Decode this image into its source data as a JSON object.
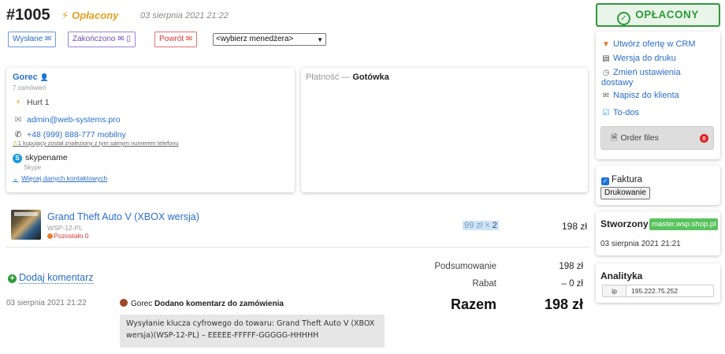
{
  "header": {
    "order_number": "#1005",
    "status": "Opłacony",
    "date": "03 sierpnia 2021 21:22"
  },
  "status_buttons": {
    "sent": "Wysłane",
    "completed": "Zakończono",
    "returned": "Powrót"
  },
  "manager_select": {
    "value": "<wybierz menedżera>"
  },
  "client": {
    "name": "Gorec",
    "orders": "7 zamówień",
    "price_group": "Hurt 1",
    "email": "admin@web-systems.pro",
    "phone": "+48 (999) 888-777 mobilny",
    "phone_warning": "1 kupujący został znaleziony z tym samym numerem telefonu",
    "skype": "skypename",
    "skype_label": "Skype",
    "more_contacts": "Więcej danych kontaktowych"
  },
  "payment": {
    "label": "Płatność —",
    "method": "Gotówka"
  },
  "product": {
    "name": "Grand Theft Auto V (XBOX wersja)",
    "sku": "WSP-12-PL",
    "stock": "Pozostało 0",
    "unit_price": "99 zł ×",
    "quantity": "2",
    "line_total": "198 zł"
  },
  "summary": {
    "subtotal_label": "Podsumowanie",
    "subtotal_value": "198 zł",
    "discount_label": "Rabat",
    "discount_value": "– 0 zł",
    "total_label": "Razem",
    "total_value": "198 zł"
  },
  "comments": {
    "add_label": "Dodaj komentarz",
    "items": [
      {
        "date": "03 sierpnia 2021 21:22",
        "author": "Gorec",
        "action": "Dodano komentarz do zamówienia",
        "body": "Wysyłanie klucza cyfrowego do towaru: Grand Theft Auto V (XBOX wersja)(WSP-12-PL) – EEEEE-FFFFF-GGGGG-HHHHH"
      }
    ]
  },
  "sidebar": {
    "paid_label": "OPŁACONY",
    "actions": {
      "crm_offer": "Utwórz ofertę w CRM",
      "print_version": "Wersja do druku",
      "change_delivery": "Zmień ustawienia dostawy",
      "write_client": "Napisz do klienta",
      "todos": "To-dos",
      "order_files": "Order files",
      "order_files_count": "0"
    },
    "invoice": {
      "label": "Faktura",
      "print_button": "Drukowanie"
    },
    "created": {
      "title": "Stworzony",
      "source": "master.wsp.shop.pl",
      "date": "03 sierpnia 2021 21:21"
    },
    "analytics": {
      "title": "Analityka",
      "ip_key": "ip",
      "ip_value": "195.222.75.252"
    }
  },
  "colors": {
    "accent": "#2a6ec9",
    "paid": "#2e9a3a",
    "status": "#e0a020",
    "danger": "#d33"
  }
}
